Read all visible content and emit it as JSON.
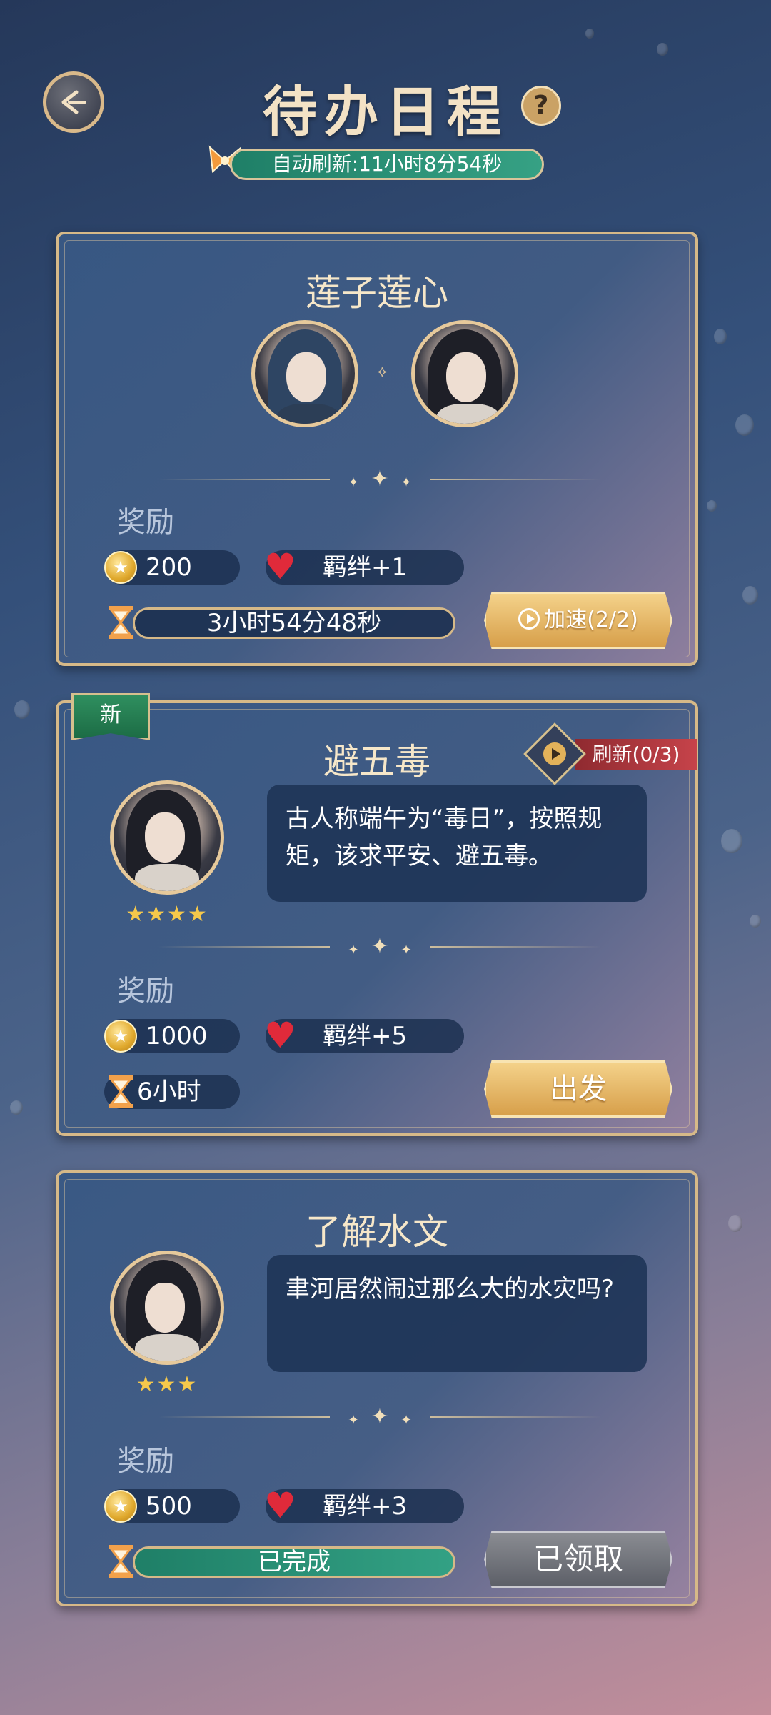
{
  "header": {
    "title": "待办日程",
    "help": "?",
    "auto_refresh": "自动刷新:11小时8分54秒"
  },
  "cards": [
    {
      "title": "莲子莲心",
      "reward_label": "奖励",
      "coins": "200",
      "bond": "羁绊+1",
      "timer": "3小时54分48秒",
      "action": "加速(2/2)"
    },
    {
      "tag": "新",
      "title": "避五毒",
      "refresh": "刷新(0/3)",
      "dialog": "古人称端午为“毒日”，按照规矩，该求平安、避五毒。",
      "stars": "★★★★",
      "reward_label": "奖励",
      "coins": "1000",
      "bond": "羁绊+5",
      "duration": "6小时",
      "action": "出发"
    },
    {
      "title": "了解水文",
      "dialog": "聿河居然闹过那么大的水灾吗?",
      "stars": "★★★",
      "reward_label": "奖励",
      "coins": "500",
      "bond": "羁绊+3",
      "status": "已完成",
      "action": "已领取"
    }
  ],
  "colors": {
    "gold": "#d6b988",
    "green_bar": "#1f7f67",
    "red_tag": "#c6434a"
  }
}
